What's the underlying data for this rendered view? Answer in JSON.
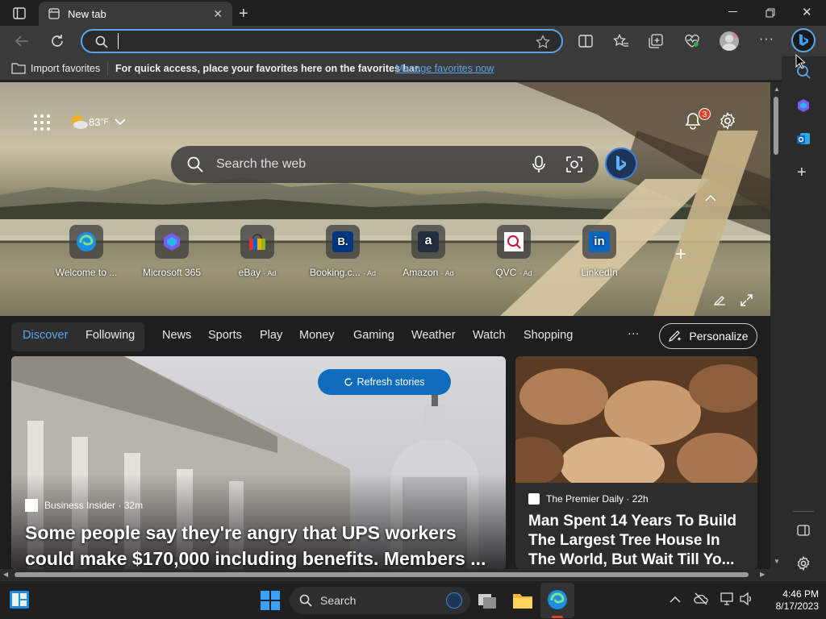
{
  "tab": {
    "title": "New tab"
  },
  "address": {
    "value": "",
    "placeholder": ""
  },
  "favorites_bar": {
    "import_label": "Import favorites",
    "hint": "For quick access, place your favorites here on the favorites bar.",
    "manage_link": "Manage favorites now"
  },
  "weather": {
    "temp": "83",
    "unit": "°F"
  },
  "notifications": {
    "count": "3"
  },
  "search": {
    "placeholder": "Search the web"
  },
  "quick_links": [
    {
      "label": "Welcome to ...",
      "ad": "",
      "icon": "edge-logo-icon"
    },
    {
      "label": "Microsoft 365",
      "ad": "",
      "icon": "microsoft365-icon"
    },
    {
      "label": "eBay",
      "ad": "· Ad",
      "icon": "ebay-icon"
    },
    {
      "label": "Booking.c...",
      "ad": "· Ad",
      "icon": "booking-icon"
    },
    {
      "label": "Amazon",
      "ad": "· Ad",
      "icon": "amazon-icon"
    },
    {
      "label": "QVC",
      "ad": "· Ad",
      "icon": "qvc-icon"
    },
    {
      "label": "LinkedIn",
      "ad": "",
      "icon": "linkedin-icon"
    }
  ],
  "feed_nav": {
    "discover": "Discover",
    "following": "Following",
    "items": [
      "News",
      "Sports",
      "Play",
      "Money",
      "Gaming",
      "Weather",
      "Watch",
      "Shopping"
    ],
    "more": "···",
    "personalize": "Personalize"
  },
  "refresh_label": "Refresh stories",
  "stories": [
    {
      "source": "Business Insider",
      "age": "32m",
      "title": "Some people say they're angry that UPS workers could make $170,000 including benefits. Members ..."
    },
    {
      "source": "The Premier Daily",
      "age": "22h",
      "title": "Man Spent 14 Years To Build The Largest Tree House In The World, But Wait Till Yo..."
    }
  ],
  "taskbar": {
    "search_label": "Search",
    "time": "4:46 PM",
    "date": "8/17/2023"
  },
  "colors": {
    "accent": "#0078d4",
    "link": "#5aa6e8",
    "badge": "#d9432a"
  }
}
